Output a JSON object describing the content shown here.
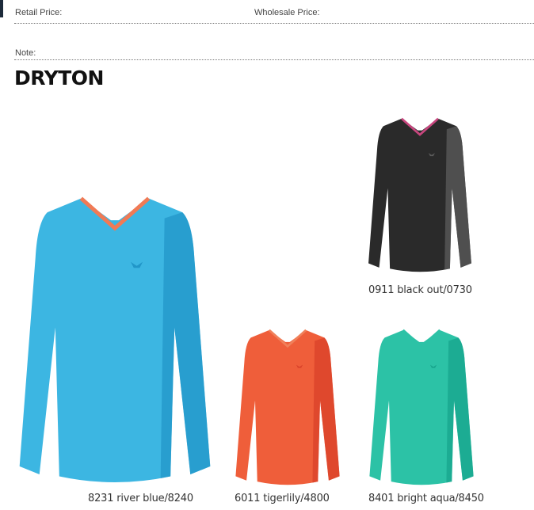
{
  "header": {
    "retail_price_label": "Retail Price:",
    "wholesale_price_label": "Wholesale Price:",
    "note_label": "Note:"
  },
  "product": {
    "name": "DRYTON",
    "variants": [
      {
        "caption": "8231 river blue/8240",
        "color": "#3cb6e2",
        "shade": "#2196c8",
        "collar": "#f07a55"
      },
      {
        "caption": "0911 black out/0730",
        "color": "#2a2a2a",
        "shade": "#5c5c5c",
        "collar": "#c8467e"
      },
      {
        "caption": "6011 tigerlily/4800",
        "color": "#ef5e3a",
        "shade": "#d9422a",
        "collar": "#f0805a"
      },
      {
        "caption": "8401 bright aqua/8450",
        "color": "#2cc2a6",
        "shade": "#17a48c",
        "collar": "#2cc2a6"
      }
    ]
  }
}
